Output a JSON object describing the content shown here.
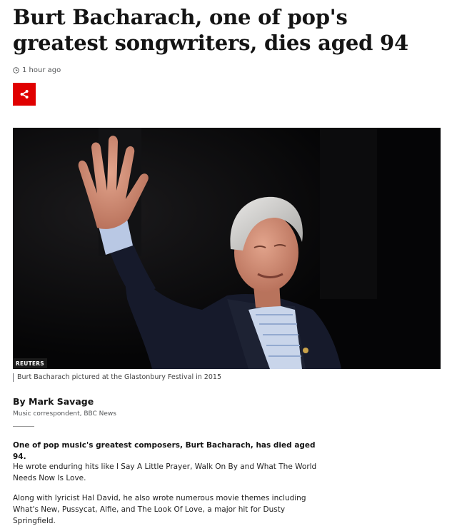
{
  "article": {
    "headline": "Burt Bacharach, one of pop's greatest songwriters, dies aged 94",
    "timestamp": "1 hour ago",
    "share_icon": "share-icon",
    "image": {
      "credit": "REUTERS",
      "caption": "Burt Bacharach pictured at the Glastonbury Festival in 2015"
    },
    "byline": {
      "name": "By Mark Savage",
      "role": "Music correspondent, BBC News"
    },
    "paragraphs": [
      "One of pop music's greatest composers, Burt Bacharach, has died aged 94.",
      "He wrote enduring hits like I Say A Little Prayer, Walk On By and What The World Needs Now Is Love.",
      "Along with lyricist Hal David, he also wrote numerous movie themes including What's New, Pussycat, Alfie, and The Look Of Love, a major hit for Dusty Springfield."
    ]
  },
  "colors": {
    "share_button": "#e00000",
    "text": "#141414",
    "muted": "#545658"
  }
}
